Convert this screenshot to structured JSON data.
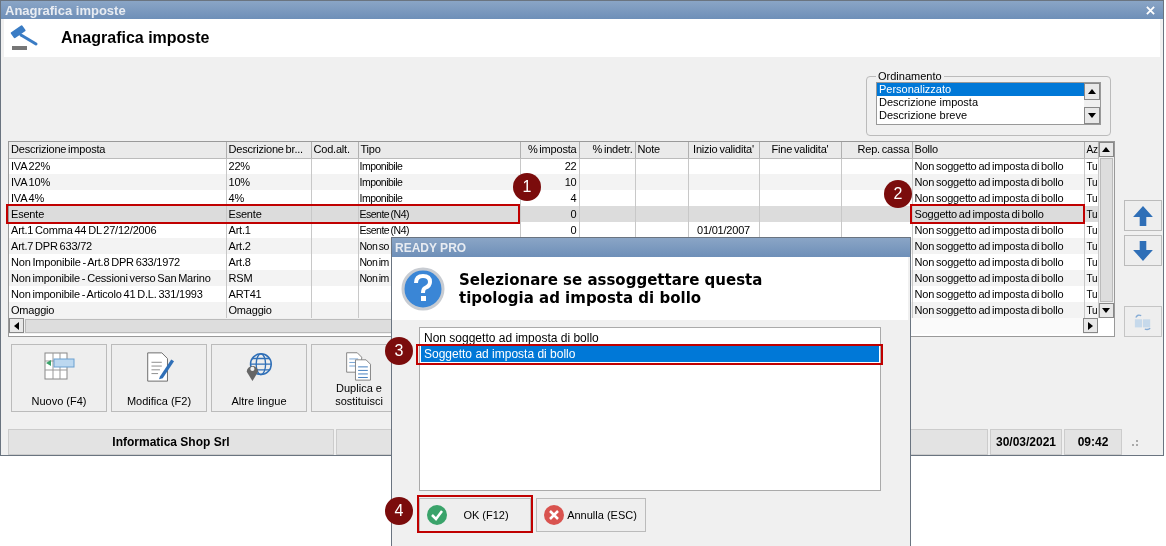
{
  "window": {
    "title": "Anagrafica imposte"
  },
  "header": {
    "title": "Anagrafica imposte"
  },
  "sort_group": {
    "label": "Ordinamento",
    "options": [
      {
        "label": "Personalizzato",
        "selected": true
      },
      {
        "label": "Descrizione imposta",
        "selected": false
      },
      {
        "label": "Descrizione breve",
        "selected": false
      }
    ]
  },
  "table": {
    "columns": [
      "Descrizione imposta",
      "Descrizione br...",
      "Cod.alt.",
      "Tipo",
      "% imposta",
      "% indetr.",
      "Note",
      "Inizio validita'",
      "Fine validita'",
      "Rep. cassa",
      "Bollo",
      "Az"
    ],
    "rows": [
      {
        "selected": false,
        "cells": [
          "IVA 22%",
          "22%",
          null,
          "Imponibile",
          "22",
          null,
          null,
          null,
          null,
          null,
          "Non soggetto ad imposta di bollo",
          "Tu"
        ]
      },
      {
        "selected": false,
        "cells": [
          "IVA 10%",
          "10%",
          null,
          "Imponibile",
          "10",
          null,
          null,
          null,
          null,
          null,
          "Non soggetto ad imposta di bollo",
          "Tu"
        ]
      },
      {
        "selected": false,
        "cells": [
          "IVA 4%",
          "4%",
          null,
          "Imponibile",
          "4",
          null,
          null,
          null,
          null,
          null,
          "Non soggetto ad imposta di bollo",
          "Tu"
        ]
      },
      {
        "selected": true,
        "cells": [
          "Esente",
          "Esente",
          null,
          "Esente (N4)",
          "0",
          null,
          null,
          null,
          null,
          null,
          "Soggetto ad imposta di bollo",
          "Tu"
        ]
      },
      {
        "selected": false,
        "cells": [
          "Art.1 Comma 44 DL 27/12/2006",
          "Art.1",
          null,
          "Esente (N4)",
          "0",
          null,
          null,
          "01/01/2007",
          null,
          null,
          "Non soggetto ad imposta di bollo",
          "Tu"
        ]
      },
      {
        "selected": false,
        "cells": [
          "Art.7 DPR 633/72",
          "Art.2",
          null,
          "Non so",
          null,
          null,
          null,
          null,
          null,
          null,
          "Non soggetto ad imposta di bollo",
          "Tu"
        ]
      },
      {
        "selected": false,
        "cells": [
          "Non Imponibile - Art.8 DPR 633/1972",
          "Art.8",
          null,
          "Non im",
          null,
          null,
          null,
          null,
          null,
          null,
          "Non soggetto ad imposta di bollo",
          "Tu"
        ]
      },
      {
        "selected": false,
        "cells": [
          "Non imponibile - Cessioni verso San Marino",
          "RSM",
          null,
          "Non im",
          null,
          null,
          null,
          null,
          null,
          null,
          "Non soggetto ad imposta di bollo",
          "Tu"
        ]
      },
      {
        "selected": false,
        "cells": [
          "Non imponibile - Articolo 41 D.L. 331/1993",
          "ART41",
          null,
          null,
          null,
          null,
          null,
          null,
          null,
          null,
          "Non soggetto ad imposta di bollo",
          "Tu"
        ]
      },
      {
        "selected": false,
        "cells": [
          "Omaggio",
          "Omaggio",
          null,
          null,
          null,
          null,
          null,
          null,
          null,
          null,
          "Non soggetto ad imposta di bollo",
          "Tu"
        ]
      }
    ]
  },
  "actions": [
    {
      "label": "Nuovo (F4)",
      "kind": "new"
    },
    {
      "label": "Modifica (F2)",
      "kind": "edit"
    },
    {
      "label": "Altre lingue",
      "kind": "languages"
    },
    {
      "label": "Duplica e sostituisci",
      "kind": "duplicate"
    }
  ],
  "status_bar": {
    "company": "Informatica Shop Srl",
    "date": "30/03/2021",
    "time": "09:42"
  },
  "dialog": {
    "title": "READY PRO",
    "message": "Selezionare se assoggettare questa tipologia ad imposta di bollo",
    "options": [
      {
        "label": "Non soggetto ad imposta di bollo",
        "selected": false
      },
      {
        "label": "Soggetto ad imposta di bollo",
        "selected": true
      }
    ],
    "buttons": [
      {
        "label": "OK (F12)",
        "kind": "ok"
      },
      {
        "label": "Annulla (ESC)",
        "kind": "cancel"
      }
    ]
  },
  "callouts": [
    {
      "number": "1"
    },
    {
      "number": "2"
    },
    {
      "number": "3"
    },
    {
      "number": "4"
    }
  ]
}
